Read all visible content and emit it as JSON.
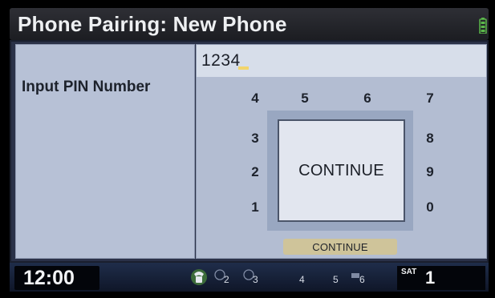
{
  "title": "Phone Pairing: New Phone",
  "left_panel": {
    "label": "Input PIN Number"
  },
  "pin_field": {
    "value": "1234"
  },
  "digits": [
    "1",
    "2",
    "3",
    "4",
    "5",
    "6",
    "7",
    "8",
    "9",
    "0"
  ],
  "continue_center": "CONTINUE",
  "continue_tab": "CONTINUE",
  "status": {
    "clock": "12:00",
    "presets": [
      "2",
      "3",
      "4",
      "5",
      "6"
    ],
    "sat_label": "SAT",
    "sat_channel": "1"
  },
  "icons": [
    "battery-icon",
    "phone-icon",
    "preset-icon"
  ],
  "colors": {
    "title_bar": "#2e2f35",
    "panel_bg": "#b7c1d6",
    "field_bg": "#d7deea",
    "cursor": "#f2d56c",
    "continue_tab": "#cfc49a"
  }
}
